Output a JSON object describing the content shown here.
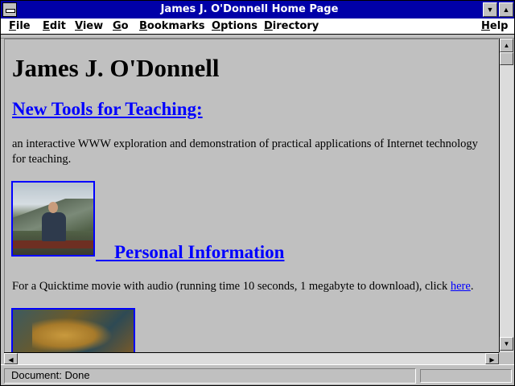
{
  "window": {
    "title": "James J. O'Donnell Home Page"
  },
  "menubar": {
    "items": [
      {
        "label": "File",
        "hotkey": "F",
        "rest": "ile"
      },
      {
        "label": "Edit",
        "hotkey": "E",
        "rest": "dit"
      },
      {
        "label": "View",
        "hotkey": "V",
        "rest": "iew"
      },
      {
        "label": "Go",
        "hotkey": "G",
        "rest": "o"
      },
      {
        "label": "Bookmarks",
        "hotkey": "B",
        "rest": "ookmarks"
      },
      {
        "label": "Options",
        "hotkey": "O",
        "rest": "ptions"
      },
      {
        "label": "Directory",
        "hotkey": "D",
        "rest": "irectory"
      },
      {
        "label": "Help",
        "hotkey": "H",
        "rest": "elp"
      }
    ]
  },
  "page": {
    "heading": "James J. O'Donnell",
    "new_tools_link": "New Tools for Teaching:",
    "intro_line1": "an interactive WWW exploration and demonstration of practical applications of Internet technology",
    "intro_line2": "for teaching.",
    "personal_link": "Personal Information",
    "movie_text": "For a Quicktime movie with audio (running time 10 seconds, 1 megabyte to download), click ",
    "here_link": "here",
    "movie_end": "."
  },
  "statusbar": {
    "text": "Document: Done"
  },
  "colors": {
    "titlebar": "#0000a8",
    "link": "#0000ff",
    "background": "#c0c0c0"
  },
  "icons": {
    "scroll_up": "triangle-up-icon",
    "scroll_down": "triangle-down-icon",
    "scroll_left": "triangle-left-icon",
    "scroll_right": "triangle-right-icon",
    "minimize": "triangle-down-icon",
    "maximize": "triangle-up-icon"
  }
}
